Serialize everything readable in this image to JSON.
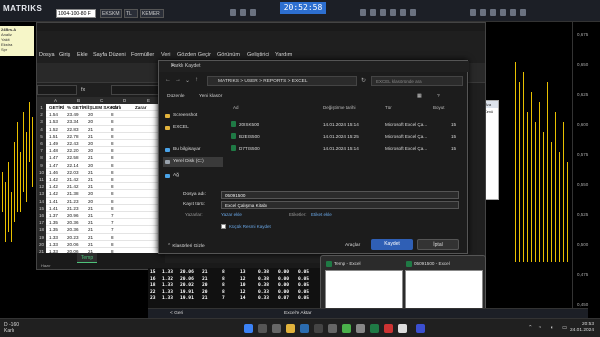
{
  "matriks": {
    "logo": "MATRIKS",
    "search_value": "1004-100-80 F",
    "field1": "EKSKM",
    "field2": "TL",
    "field3": "KEMER",
    "clock": "20:52:58",
    "ticker_lines": [
      "24Brs.A",
      "Analiz",
      "Yakit",
      "Ekstra",
      "Spr",
      "Al Sat",
      "Fark"
    ],
    "axis_labels": [
      "0,675",
      "0,650",
      "0,625",
      "0,600",
      "0,575",
      "0,550",
      "0,525",
      "0,500",
      "0,475",
      "0,450"
    ],
    "mini_panel": [
      "Ara",
      "Tümü"
    ],
    "bottom_table": [
      [
        "15",
        "1.33",
        "20.06",
        "21",
        "8",
        "13",
        "0.38",
        "0.00",
        "0.05"
      ],
      [
        "16",
        "1.32",
        "20.06",
        "21",
        "8",
        "12",
        "0.38",
        "0.00",
        "0.05"
      ],
      [
        "18",
        "1.33",
        "20.02",
        "20",
        "8",
        "10",
        "0.38",
        "0.00",
        "0.05"
      ],
      [
        "22",
        "1.33",
        "19.91",
        "20",
        "8",
        "12",
        "0.33",
        "0.00",
        "0.05"
      ],
      [
        "23",
        "1.33",
        "19.91",
        "21",
        "7",
        "14",
        "0.33",
        "0.07",
        "0.05"
      ]
    ],
    "bottom_bar": [
      "< Geri",
      "Excel'e Aktar"
    ]
  },
  "excel": {
    "menu": [
      "Dosya",
      "Giriş",
      "Ekle",
      "Sayfa Düzeni",
      "Formüller",
      "Veri",
      "Gözden Geçir",
      "Görünüm",
      "Geliştirici",
      "Yardım"
    ],
    "namebox": "",
    "fx": "fx",
    "columns": [
      "A",
      "B",
      "C",
      "D",
      "E"
    ],
    "headers": [
      "GETİRİ",
      "% GETİRİ",
      "İŞLEM SAYISI",
      "Kârlı",
      "Zarar"
    ],
    "rows": [
      [
        "1.54",
        "23.49",
        "20",
        "8"
      ],
      [
        "1.53",
        "23.34",
        "20",
        "8"
      ],
      [
        "1.52",
        "22.83",
        "21",
        "8"
      ],
      [
        "1.51",
        "22.78",
        "21",
        "8"
      ],
      [
        "1.49",
        "22.43",
        "20",
        "8"
      ],
      [
        "1.48",
        "22.20",
        "20",
        "8"
      ],
      [
        "1.47",
        "22.58",
        "21",
        "8"
      ],
      [
        "1.47",
        "22.14",
        "20",
        "8"
      ],
      [
        "1.46",
        "22.03",
        "21",
        "8"
      ],
      [
        "1.42",
        "21.42",
        "21",
        "8"
      ],
      [
        "1.42",
        "21.42",
        "21",
        "8"
      ],
      [
        "1.42",
        "21.38",
        "20",
        "8"
      ],
      [
        "1.41",
        "21.23",
        "20",
        "8"
      ],
      [
        "1.41",
        "21.23",
        "21",
        "8"
      ],
      [
        "1.37",
        "20.96",
        "21",
        "7"
      ],
      [
        "1.35",
        "20.36",
        "21",
        "7"
      ],
      [
        "1.35",
        "20.36",
        "21",
        "7"
      ],
      [
        "1.33",
        "20.23",
        "21",
        "8"
      ],
      [
        "1.33",
        "20.06",
        "21",
        "8"
      ],
      [
        "1.33",
        "20.06",
        "21",
        "8"
      ],
      [
        "1.33",
        "20.02",
        "20",
        "8"
      ]
    ],
    "sheet_tab": "Temp",
    "status": "Hazır"
  },
  "dialog": {
    "title": "Farklı Kaydet",
    "path": "MATRIKS > USER > REPORTS > EXCEL",
    "search_placeholder": "EXCEL klasöründe ara",
    "organize": "Düzenle",
    "new_folder": "Yeni klasör",
    "sidebar": [
      {
        "label": "Screenshot",
        "color": "#e2b33c"
      },
      {
        "label": "EXCEL",
        "color": "#e2b33c"
      },
      {
        "label": "Bu bilgisayar",
        "color": "#4aa3e8"
      },
      {
        "label": "Yerel Disk (C:)",
        "color": "#9aa3ad"
      },
      {
        "label": "Ağ",
        "color": "#4aa3e8"
      }
    ],
    "file_headers": [
      "Ad",
      "Değiştirme tarihi",
      "Tür",
      "Boyut"
    ],
    "files": [
      {
        "name": "20ISK500",
        "date": "14.01.2024 15:14",
        "type": "Microsoft Excel Ça...",
        "size": "15"
      },
      {
        "name": "B2EIS500",
        "date": "14.01.2024 15:25",
        "type": "Microsoft Excel Ça...",
        "size": "15"
      },
      {
        "name": "D7TIS500",
        "date": "14.01.2024 15:14",
        "type": "Microsoft Excel Ça...",
        "size": "15"
      }
    ],
    "filename_label": "Dosya adı:",
    "filename_value": "05091500",
    "filetype_label": "Kayıt türü:",
    "filetype_value": "Excel Çalışma Kitabı",
    "authors_label": "Yazarlar:",
    "authors_value": "Yazar ekle",
    "tags_label": "Etiketler:",
    "tags_value": "Etiket ekle",
    "thumbnail_label": "Küçük Resmi Kaydet",
    "hide_folders": "Klasörleri Gizle",
    "tools": "Araçlar",
    "save": "Kaydet",
    "cancel": "İptal"
  },
  "thumbnails": [
    {
      "title": "Temp - Excel"
    },
    {
      "title": "05091500 - Excel"
    }
  ],
  "taskbar": {
    "weather_temp": "D -160",
    "weather_text": "Karlı",
    "time": "20:53",
    "date": "24.01.2024"
  }
}
